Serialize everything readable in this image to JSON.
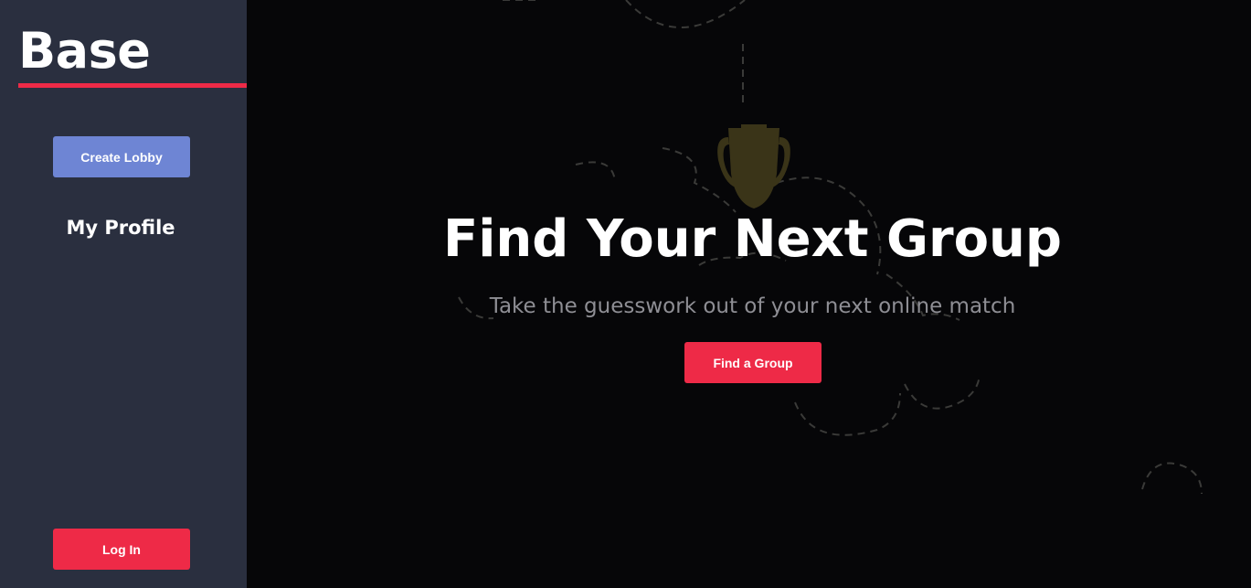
{
  "sidebar": {
    "brand": "Base",
    "create_lobby_label": "Create Lobby",
    "my_profile_label": "My Profile",
    "login_label": "Log In"
  },
  "hero": {
    "title": "Find Your Next Group",
    "subtitle": "Take the guesswork out of your next online match",
    "cta_label": "Find a Group",
    "background_icon": "trophy-icon"
  },
  "colors": {
    "sidebar_bg": "#2a2f3f",
    "main_bg": "#060608",
    "accent_red": "#ee2a47",
    "accent_blue": "#6e85d4"
  }
}
